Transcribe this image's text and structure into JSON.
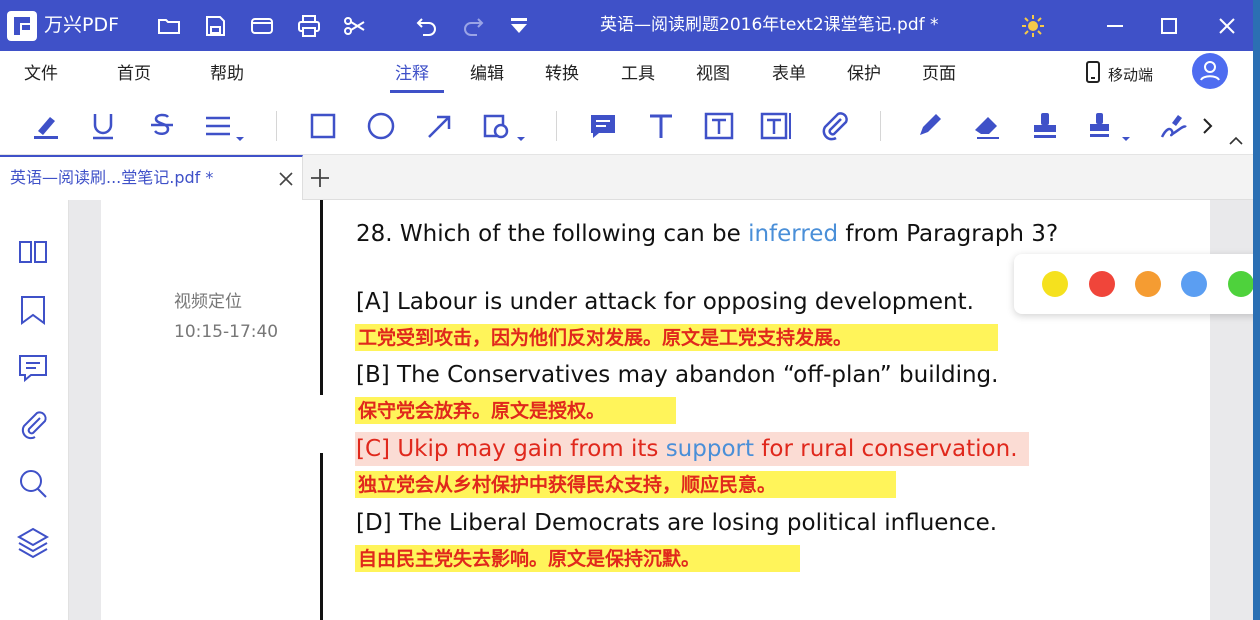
{
  "app": {
    "name": "万兴PDF",
    "document_title": "英语—阅读刷题2016年text2课堂笔记.pdf *"
  },
  "menu": {
    "items": [
      "文件",
      "首页",
      "帮助",
      "注释",
      "编辑",
      "转换",
      "工具",
      "视图",
      "表单",
      "保护",
      "页面"
    ],
    "active": "注释",
    "mobile_doc_label": "移动端"
  },
  "toolbar": {
    "tools": [
      "highlight-pen-icon",
      "underline-icon",
      "strikethrough-icon",
      "line-menu-icon",
      "rectangle-icon",
      "ellipse-icon",
      "arrow-icon",
      "shape-menu-icon",
      "sticky-note-icon",
      "text-icon",
      "text-box-icon",
      "text-callout-icon",
      "attachment-icon",
      "pencil-icon",
      "eraser-icon",
      "stamp-icon",
      "stamp-menu-icon",
      "signature-icon"
    ]
  },
  "tab": {
    "label": "英语—阅读刷...堂笔记.pdf *"
  },
  "sidebar": {
    "icons": [
      "thumbnails-icon",
      "bookmark-icon",
      "comment-icon",
      "attachment-icon",
      "search-icon",
      "layers-icon"
    ]
  },
  "note": {
    "line1": "视频定位",
    "line2": "10:15-17:40"
  },
  "question": {
    "stem_before": "28. Which of the following can be ",
    "stem_keyword": "inferred",
    "stem_after": " from Paragraph 3?",
    "options": [
      {
        "text": "[A] Labour is under attack for opposing development.",
        "note": "工党受到攻击，因为他们反对发展。原文是工党支持发展。"
      },
      {
        "text": "[B] The Conservatives may abandon “off-plan” building.",
        "note": "保守党会放弃。原文是授权。"
      },
      {
        "text_before": "[C] Ukip may gain from its ",
        "text_keyword": "support",
        "text_after": " for rural conservation.",
        "note": "独立党会从乡村保护中获得民众支持，顺应民意。"
      },
      {
        "text": "[D] The Liberal Democrats are losing political influence.",
        "note": "自由民主党失去影响。原文是保持沉默。"
      }
    ]
  },
  "palette": {
    "colors": [
      "#f5e11e",
      "#f0453a",
      "#f59c32",
      "#5b9ef2",
      "#4ed23c"
    ]
  },
  "colors": {
    "brand": "#3f51c8",
    "highlight_yellow": "#fff45a",
    "highlight_pink": "#fbdcd4",
    "annotation_red": "#e0281c",
    "keyword_blue": "#4a8fd8"
  }
}
